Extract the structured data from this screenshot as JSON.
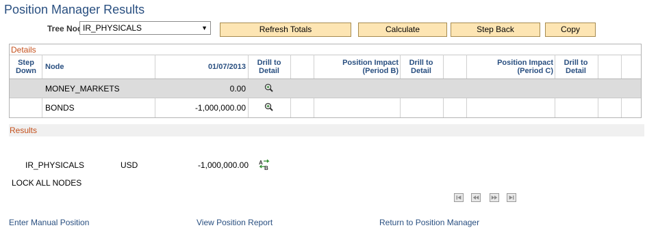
{
  "page_title": "Position Manager Results",
  "tree_node": {
    "label": "Tree Node",
    "value": "IR_PHYSICALS"
  },
  "buttons": {
    "refresh": "Refresh Totals",
    "calculate": "Calculate",
    "step_back": "Step Back",
    "copy": "Copy"
  },
  "details": {
    "title": "Details",
    "headers": {
      "step_down": "Step\nDown",
      "node": "Node",
      "date": "01/07/2013",
      "drill1": "Drill to\nDetail",
      "impact_b": "Position Impact\n(Period B)",
      "drill2": "Drill to\nDetail",
      "impact_c": "Position Impact\n(Period C)",
      "drill3": "Drill to\nDetail"
    },
    "rows": [
      {
        "node": "MONEY_MARKETS",
        "value": "0.00"
      },
      {
        "node": "BONDS",
        "value": "-1,000,000.00"
      }
    ]
  },
  "results": {
    "title": "Results",
    "node": "IR_PHYSICALS",
    "currency": "USD",
    "amount": "-1,000,000.00",
    "lock_text": "LOCK ALL NODES"
  },
  "links": {
    "manual": "Enter Manual Position",
    "report": "View Position Report",
    "return": "Return to Position Manager"
  },
  "icons": [
    "magnifier-icon",
    "sort-ab-icon",
    "first-page-icon",
    "previous-page-icon",
    "next-page-icon",
    "last-page-icon"
  ],
  "colors": {
    "title": "#294f80",
    "section": "#c4501c",
    "button": "#fde5b3",
    "selected_row": "#dcdcdc"
  }
}
